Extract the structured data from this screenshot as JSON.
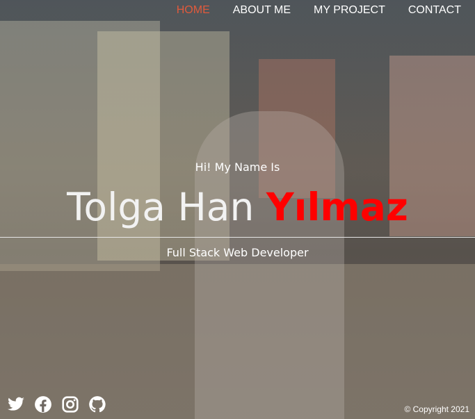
{
  "nav": {
    "items": [
      {
        "label": "HOME",
        "active": true
      },
      {
        "label": "ABOUT ME",
        "active": false
      },
      {
        "label": "MY PROJECT",
        "active": false
      },
      {
        "label": "CONTACT",
        "active": false
      }
    ]
  },
  "hero": {
    "greeting": "Hi! My Name Is",
    "first_name": "Tolga Han",
    "last_name": "Yılmaz",
    "role": "Full Stack Web Developer"
  },
  "social": {
    "icons": [
      "twitter-icon",
      "facebook-icon",
      "instagram-icon",
      "github-icon"
    ]
  },
  "footer": {
    "copyright": "© Copyright 2021"
  },
  "colors": {
    "accent": "#e15a3c",
    "last_name": "#ff0000",
    "text": "#ffffff"
  }
}
